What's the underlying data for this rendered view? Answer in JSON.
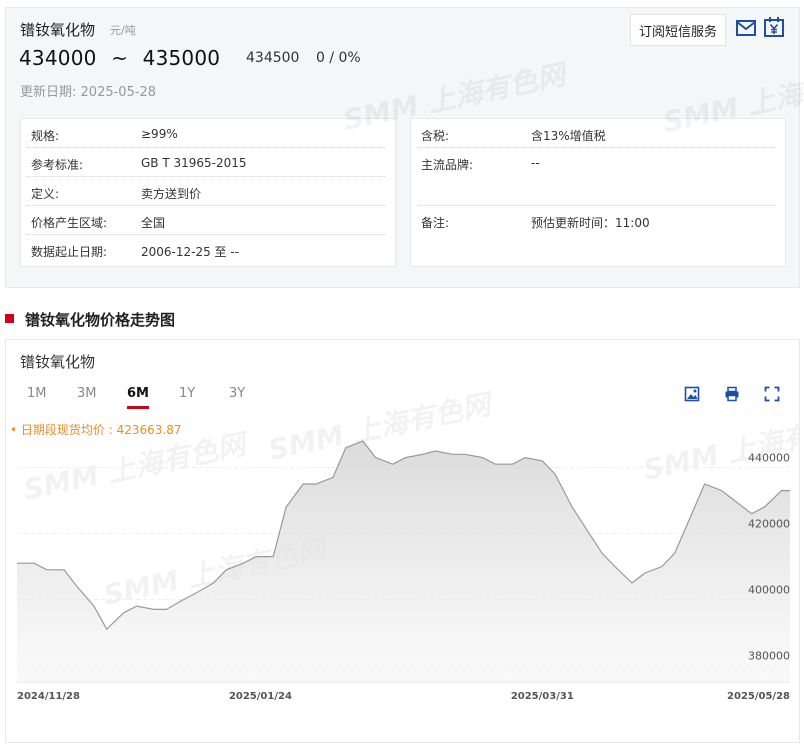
{
  "product": {
    "name": "镨钕氧化物",
    "unit": "元/吨",
    "price_low": "434000",
    "price_high": "435000",
    "tilde": "~",
    "avg": "434500",
    "change": "0 / 0%",
    "update_label": "更新日期:",
    "update_date": "2025-05-28",
    "subscribe_label": "订阅短信服务"
  },
  "info_left": [
    {
      "label": "规格:",
      "value": "≥99%"
    },
    {
      "label": "参考标准:",
      "value": "GB T 31965-2015"
    },
    {
      "label": "定义:",
      "value": "卖方送到价"
    },
    {
      "label": "价格产生区域:",
      "value": "全国"
    },
    {
      "label": "数据起止日期:",
      "value": "2006-12-25 至 --"
    }
  ],
  "info_right": [
    {
      "label": "含税:",
      "value": "含13%增值税"
    },
    {
      "label": "主流品牌:",
      "value": "--"
    },
    {
      "label": "备注:",
      "value": "预估更新时间：11:00"
    }
  ],
  "section": {
    "title": "镨钕氧化物价格走势图"
  },
  "chart_panel": {
    "name": "镨钕氧化物",
    "ranges": [
      "1M",
      "3M",
      "6M",
      "1Y",
      "3Y"
    ],
    "active_range": "6M",
    "avg_label": "• 日期段现货均价 : 423663.87"
  },
  "watermark": "SMM 上海有色网",
  "icons": {
    "mail": "mail-icon",
    "calendar": "calendar-yuan-icon",
    "download": "image-download-icon",
    "print": "print-icon",
    "fullscreen": "fullscreen-icon"
  },
  "colors": {
    "accent": "#d0021b",
    "avg_text": "#f08a24",
    "line": "#999999",
    "icon_blue": "#1f4fa3"
  },
  "chart_data": {
    "type": "area",
    "x_tick_labels": [
      "2024/11/28",
      "2025/01/24",
      "2025/03/31",
      "2025/05/28"
    ],
    "y_tick_labels": [
      "380000",
      "400000",
      "420000",
      "440000"
    ],
    "ylim": [
      375000,
      455000
    ],
    "grid": true,
    "x": [
      "2024-11-28",
      "2024-12-02",
      "2024-12-05",
      "2024-12-09",
      "2024-12-12",
      "2024-12-16",
      "2024-12-19",
      "2024-12-23",
      "2024-12-26",
      "2024-12-30",
      "2025-01-02",
      "2025-01-06",
      "2025-01-09",
      "2025-01-13",
      "2025-01-16",
      "2025-01-20",
      "2025-01-23",
      "2025-01-27",
      "2025-01-30",
      "2025-02-03",
      "2025-02-06",
      "2025-02-10",
      "2025-02-13",
      "2025-02-17",
      "2025-02-20",
      "2025-02-24",
      "2025-02-27",
      "2025-03-03",
      "2025-03-06",
      "2025-03-10",
      "2025-03-13",
      "2025-03-17",
      "2025-03-20",
      "2025-03-24",
      "2025-03-27",
      "2025-03-31",
      "2025-04-03",
      "2025-04-07",
      "2025-04-10",
      "2025-04-14",
      "2025-04-17",
      "2025-04-21",
      "2025-04-24",
      "2025-04-28",
      "2025-05-01",
      "2025-05-05",
      "2025-05-08",
      "2025-05-12",
      "2025-05-15",
      "2025-05-19",
      "2025-05-22",
      "2025-05-26",
      "2025-05-28"
    ],
    "values": [
      411000,
      411000,
      409000,
      409000,
      404000,
      398000,
      391000,
      396000,
      398000,
      397000,
      397000,
      400000,
      402000,
      405000,
      409000,
      411000,
      413000,
      413000,
      428000,
      435000,
      435000,
      437000,
      446000,
      448000,
      443000,
      441000,
      443000,
      444000,
      445000,
      444000,
      444000,
      443000,
      441000,
      441000,
      443000,
      442000,
      438000,
      428000,
      422000,
      414000,
      410000,
      405000,
      408000,
      410000,
      414000,
      426000,
      435000,
      433000,
      430000,
      426000,
      428000,
      433000,
      433000
    ]
  }
}
